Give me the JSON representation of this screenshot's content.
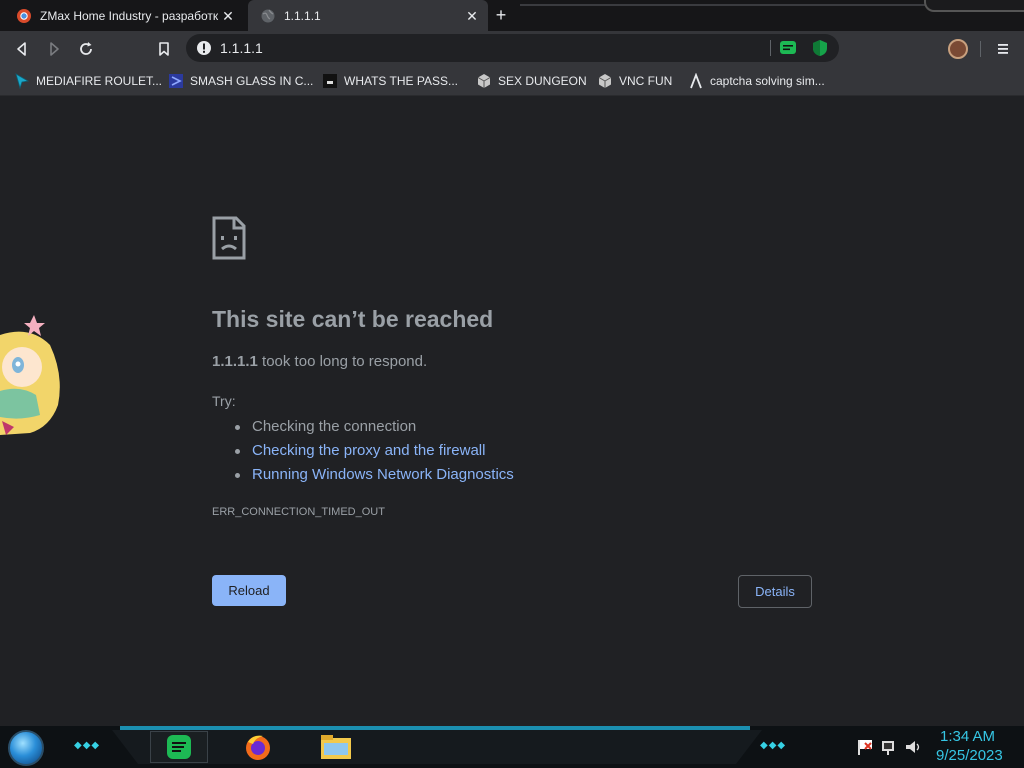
{
  "tabs": [
    {
      "title": "ZMax Home Industry - разработк",
      "favicon": "chromium-icon",
      "active": false
    },
    {
      "title": "1.1.1.1",
      "favicon": "globe-icon",
      "active": true
    }
  ],
  "toolbar": {
    "url": "1.1.1.1",
    "security": "info-icon",
    "extensions": [
      "message-extension-icon",
      "shield-extension-icon"
    ]
  },
  "bookmarks": [
    {
      "label": "MEDIAFIRE ROULET...",
      "icon": "cursor-icon"
    },
    {
      "label": "SMASH GLASS IN C...",
      "icon": "vs-icon"
    },
    {
      "label": "WHATS THE PASS...",
      "icon": "mask-icon"
    },
    {
      "label": "SEX DUNGEON",
      "icon": "cube-icon"
    },
    {
      "label": "VNC FUN",
      "icon": "cube-icon"
    },
    {
      "label": "captcha solving sim...",
      "icon": "lambda-icon"
    }
  ],
  "error": {
    "title": "This site can’t be reached",
    "host": "1.1.1.1",
    "summary_rest": " took too long to respond.",
    "try_label": "Try:",
    "suggestions": [
      "Checking the connection",
      "Checking the proxy and the firewall",
      "Running Windows Network Diagnostics"
    ],
    "code": "ERR_CONNECTION_TIMED_OUT",
    "reload_label": "Reload",
    "details_label": "Details"
  },
  "taskbar": {
    "apps": [
      "spotify-icon",
      "firefox-icon",
      "file-explorer-icon"
    ],
    "tray": [
      "flag-icon",
      "network-icon",
      "volume-icon"
    ],
    "time": "1:34 AM",
    "date": "9/25/2023"
  },
  "colors": {
    "page_bg": "#202124",
    "link": "#8ab4f8",
    "text_muted": "#9aa0a6",
    "clock": "#36c6e4"
  }
}
